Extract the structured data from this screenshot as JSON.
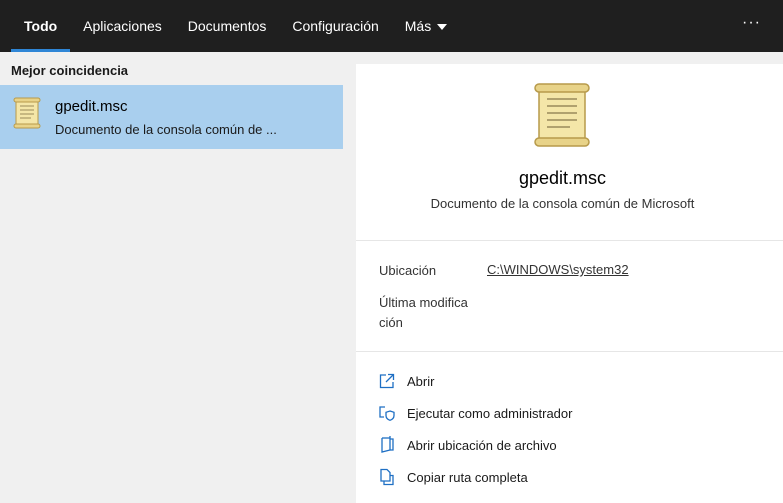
{
  "tabs": [
    {
      "label": "Todo"
    },
    {
      "label": "Aplicaciones"
    },
    {
      "label": "Documentos"
    },
    {
      "label": "Configuración"
    },
    {
      "label": "Más"
    }
  ],
  "more_button": "···",
  "left": {
    "section_title": "Mejor coincidencia",
    "result": {
      "name": "gpedit.msc",
      "description": "Documento de la consola común de ..."
    }
  },
  "preview": {
    "title": "gpedit.msc",
    "subtitle": "Documento de la consola común de Microsoft",
    "location_label": "Ubicación",
    "location_value": "C:\\WINDOWS\\system32",
    "modified_label_line1": "Última modifica",
    "modified_label_line2": "ción",
    "actions": [
      {
        "label": "Abrir",
        "icon": "open-icon"
      },
      {
        "label": "Ejecutar como administrador",
        "icon": "shield-icon"
      },
      {
        "label": "Abrir ubicación de archivo",
        "icon": "folder-icon"
      },
      {
        "label": "Copiar ruta completa",
        "icon": "copy-icon"
      }
    ]
  },
  "colors": {
    "topbar": "#1f1f1f",
    "accent": "#2f86d6",
    "selection": "#a9cfee",
    "icon_blue": "#1e6fc4"
  }
}
